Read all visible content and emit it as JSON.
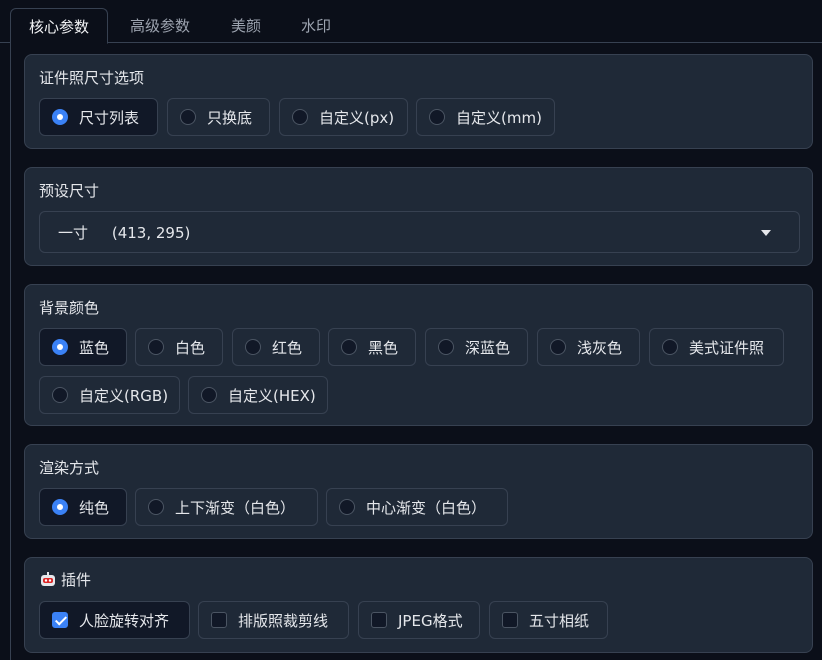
{
  "tabs": [
    {
      "label": "核心参数",
      "active": true
    },
    {
      "label": "高级参数",
      "active": false
    },
    {
      "label": "美颜",
      "active": false
    },
    {
      "label": "水印",
      "active": false
    }
  ],
  "size_options": {
    "label": "证件照尺寸选项",
    "options": [
      "尺寸列表",
      "只换底",
      "自定义(px)",
      "自定义(mm)"
    ],
    "selected": "尺寸列表"
  },
  "preset_size": {
    "label": "预设尺寸",
    "value": "一寸     (413, 295)"
  },
  "background_color": {
    "label": "背景颜色",
    "options": [
      "蓝色",
      "白色",
      "红色",
      "黑色",
      "深蓝色",
      "浅灰色",
      "美式证件照",
      "自定义(RGB)",
      "自定义(HEX)"
    ],
    "selected": "蓝色"
  },
  "render_mode": {
    "label": "渲染方式",
    "options": [
      "纯色",
      "上下渐变（白色）",
      "中心渐变（白色）"
    ],
    "selected": "纯色"
  },
  "plugins": {
    "label": "插件",
    "icon": "robot-icon",
    "options": [
      {
        "label": "人脸旋转对齐",
        "checked": true
      },
      {
        "label": "排版照裁剪线",
        "checked": false
      },
      {
        "label": "JPEG格式",
        "checked": false
      },
      {
        "label": "五寸相纸",
        "checked": false
      }
    ]
  },
  "colors": {
    "accent": "#3b82f6",
    "panel": "#1f2937",
    "background": "#0b0f19",
    "border": "#374151"
  }
}
